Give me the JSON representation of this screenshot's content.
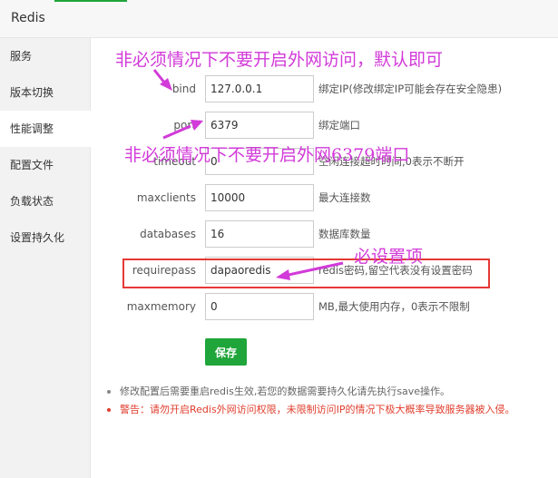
{
  "window": {
    "title": "Redis"
  },
  "sidebar": {
    "items": [
      {
        "label": "服务"
      },
      {
        "label": "版本切换"
      },
      {
        "label": "性能调整"
      },
      {
        "label": "配置文件"
      },
      {
        "label": "负载状态"
      },
      {
        "label": "设置持久化"
      }
    ],
    "active_index": 2
  },
  "form": {
    "fields": [
      {
        "label": "bind",
        "value": "127.0.0.1",
        "desc": "绑定IP(修改绑定IP可能会存在安全隐患)"
      },
      {
        "label": "port",
        "value": "6379",
        "desc": "绑定端口"
      },
      {
        "label": "timeout",
        "value": "0",
        "desc": "空闲连接超时时间,0表示不断开"
      },
      {
        "label": "maxclients",
        "value": "10000",
        "desc": "最大连接数"
      },
      {
        "label": "databases",
        "value": "16",
        "desc": "数据库数量"
      },
      {
        "label": "requirepass",
        "value": "dapaoredis",
        "desc": "redis密码,留空代表没有设置密码"
      },
      {
        "label": "maxmemory",
        "value": "0",
        "desc": "MB,最大使用内存，0表示不限制"
      }
    ],
    "save_label": "保存"
  },
  "notes": [
    "修改配置后需要重启redis生效,若您的数据需要持久化请先执行save操作。",
    "警告：请勿开启Redis外网访问权限，未限制访问IP的情况下极大概率导致服务器被入侵。"
  ],
  "annotations": {
    "note1": "非必须情况下不要开启外网访问，默认即可",
    "note2": "非必须情况下不要开启外网6379端口",
    "note3": "必设置项",
    "color": "#d23ad9",
    "box_color": "#e53935"
  },
  "colors": {
    "accent": "#20a53a",
    "warning": "#e03e2d"
  }
}
